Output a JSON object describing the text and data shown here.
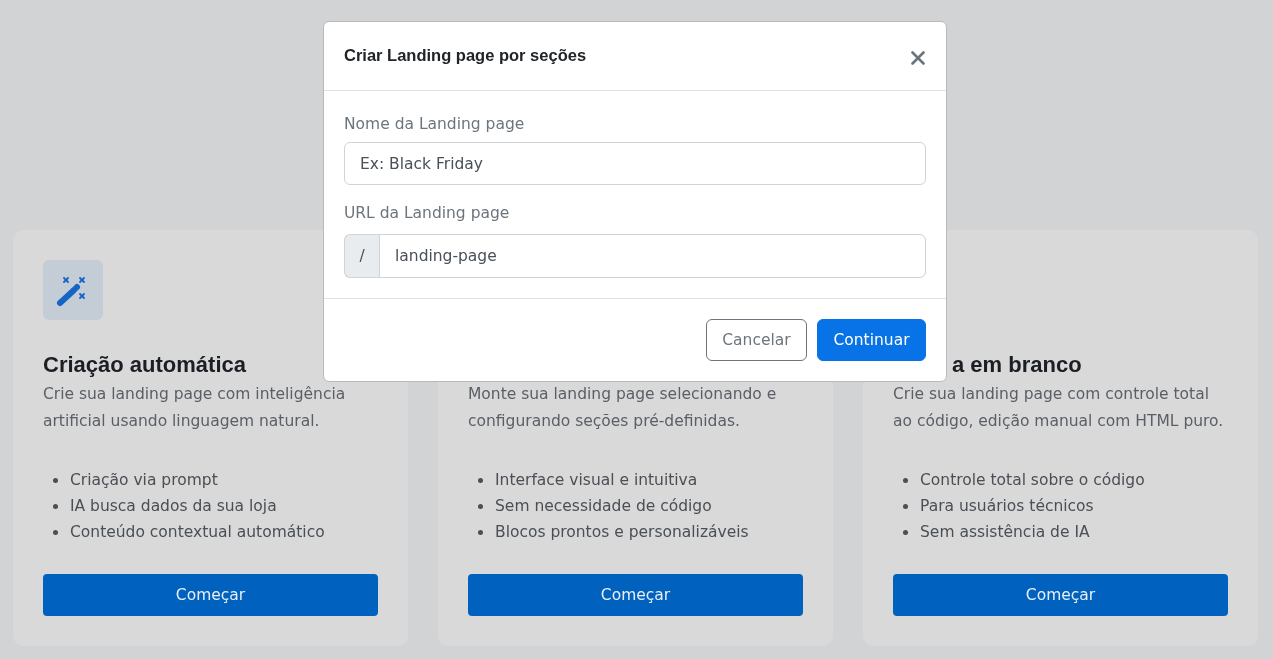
{
  "cards": [
    {
      "icon": true,
      "title": "Criação automática",
      "description": "Crie sua landing page com inteligência artificial usando linguagem natural.",
      "features": [
        "Criação via prompt",
        "IA busca dados da sua loja",
        "Conteúdo contextual automático"
      ],
      "button": "Começar"
    },
    {
      "icon": false,
      "description": "Monte sua landing page selecionando e configurando seções pré-definidas.",
      "features": [
        "Interface visual e intuitiva",
        "Sem necessidade de código",
        "Blocos prontos e personalizáveis"
      ],
      "button": "Começar"
    },
    {
      "icon": false,
      "title": "a em branco",
      "description": "Crie sua landing page com controle total ao código, edição manual com HTML puro.",
      "features": [
        "Controle total sobre o código",
        "Para usuários técnicos",
        "Sem assistência de IA"
      ],
      "button": "Começar"
    }
  ],
  "dialog": {
    "title": "Criar Landing page por seções",
    "fields": [
      {
        "kind": "text",
        "label": "Nome da Landing page",
        "placeholder": "Ex: Black Friday"
      },
      {
        "kind": "prefixed",
        "label": "URL da Landing page",
        "prefix": "/",
        "value": "landing-page"
      }
    ],
    "buttons": [
      {
        "kind": "secondary",
        "label": "Cancelar"
      },
      {
        "kind": "primary",
        "label": "Continuar"
      }
    ]
  }
}
